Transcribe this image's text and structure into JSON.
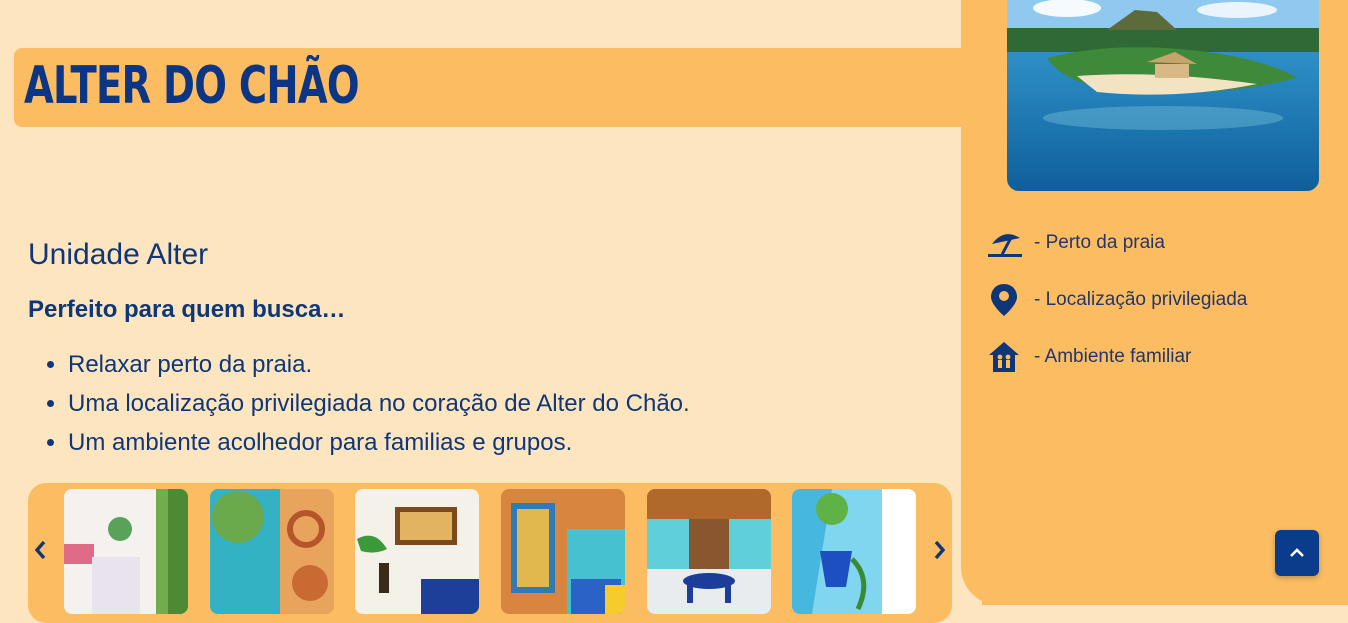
{
  "header": {
    "title": "ALTER DO CHÃO"
  },
  "features": [
    {
      "icon": "beach-umbrella-icon",
      "label": "- Perto da praia"
    },
    {
      "icon": "location-pin-icon",
      "label": "- Localização privilegiada"
    },
    {
      "icon": "family-home-icon",
      "label": "- Ambiente familiar"
    }
  ],
  "main": {
    "heading": "Unidade Alter",
    "subheading": "Perfeito para quem busca…",
    "bullets": [
      "Relaxar perto da praia.",
      "Uma localização privilegiada no coração de Alter do Chão.",
      "Um ambiente acolhedor para familias e grupos."
    ]
  },
  "carousel": {
    "prev_icon": "chevron-left-icon",
    "next_icon": "chevron-right-icon"
  },
  "scroll_top": {
    "icon": "chevron-up-icon"
  },
  "colors": {
    "background": "#fde5c0",
    "accent_orange": "#fcbd62",
    "navy": "#0f3778"
  }
}
